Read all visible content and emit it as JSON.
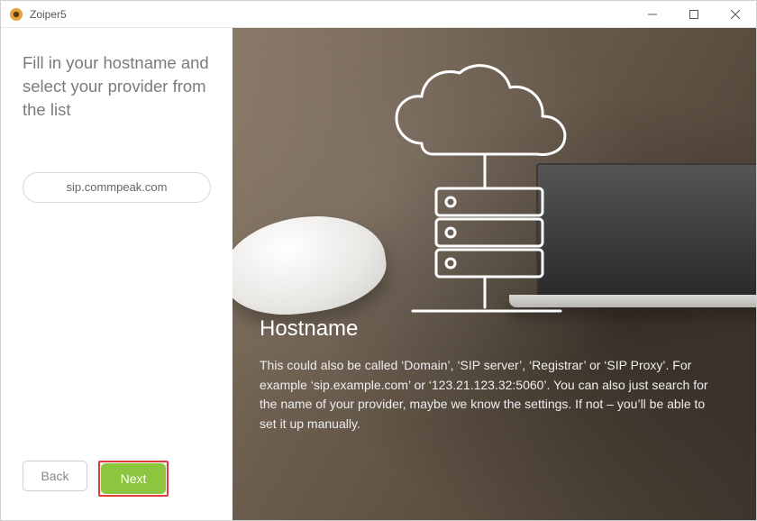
{
  "titlebar": {
    "app_name": "Zoiper5"
  },
  "left": {
    "instructions": "Fill in your hostname and select your provider from the list",
    "hostname_value": "sip.commpeak.com",
    "back_label": "Back",
    "next_label": "Next"
  },
  "right": {
    "heading": "Hostname",
    "body": "This could also be called ‘Domain’, ‘SIP server’, ‘Registrar’ or ‘SIP Proxy’. For example ‘sip.example.com’ or ‘123.21.123.32:5060’. You can also just search for the name of your provider, maybe we know the settings. If not – you’ll be able to set it up manually."
  }
}
